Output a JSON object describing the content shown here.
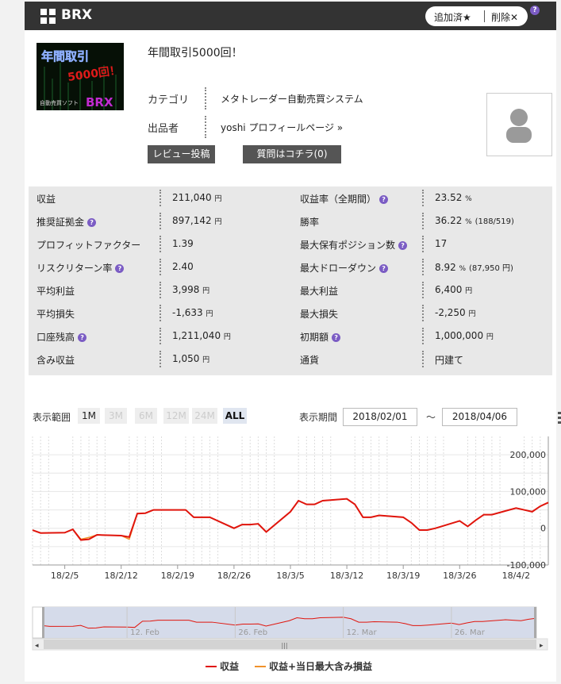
{
  "header": {
    "brand": "BRX",
    "added_label": "追加済★",
    "delete_label": "削除✕",
    "help": "?"
  },
  "product": {
    "title": "年間取引5000回！",
    "thumb_text_1": "年間取引",
    "thumb_text_2": "5000回！",
    "thumb_text_3": "自動売買ソフト",
    "thumb_text_4": "BRX",
    "category_label": "カテゴリ",
    "category_value": "メタトレーダー自動売買システム",
    "seller_label": "出品者",
    "seller_value": "yoshi プロフィールページ »",
    "review_btn": "レビュー投稿",
    "question_btn": "質問はコチラ(0)"
  },
  "stats": [
    {
      "l": "収益",
      "lq": false,
      "v": "211,040",
      "vu": "円",
      "r": "収益率（全期間）",
      "rq": true,
      "rv": "23.52",
      "ru": "%",
      "rx": ""
    },
    {
      "l": "推奨証拠金",
      "lq": true,
      "v": "897,142",
      "vu": "円",
      "r": "勝率",
      "rq": false,
      "rv": "36.22",
      "ru": "%",
      "rx": "(188/519)"
    },
    {
      "l": "プロフィットファクター",
      "lq": false,
      "v": "1.39",
      "vu": "",
      "r": "最大保有ポジション数",
      "rq": true,
      "rv": "17",
      "ru": "",
      "rx": ""
    },
    {
      "l": "リスクリターン率",
      "lq": true,
      "v": "2.40",
      "vu": "",
      "r": "最大ドローダウン",
      "rq": true,
      "rv": "8.92",
      "ru": "%",
      "rx": "(87,950 円)"
    },
    {
      "l": "平均利益",
      "lq": false,
      "v": "3,998",
      "vu": "円",
      "r": "最大利益",
      "rq": false,
      "rv": "6,400",
      "ru": "円",
      "rx": ""
    },
    {
      "l": "平均損失",
      "lq": false,
      "v": "-1,633",
      "vu": "円",
      "r": "最大損失",
      "rq": false,
      "rv": "-2,250",
      "ru": "円",
      "rx": ""
    },
    {
      "l": "口座残高",
      "lq": true,
      "v": "1,211,040",
      "vu": "円",
      "r": "初期額",
      "rq": true,
      "rv": "1,000,000",
      "ru": "円",
      "rx": ""
    },
    {
      "l": "含み収益",
      "lq": false,
      "v": "1,050",
      "vu": "円",
      "r": "通貨",
      "rq": false,
      "rv": "円建て",
      "ru": "",
      "rx": ""
    }
  ],
  "controls": {
    "range_label": "表示範囲",
    "ranges": [
      "1M",
      "3M",
      "6M",
      "12M",
      "24M",
      "ALL"
    ],
    "period_label": "表示期間",
    "date_from": "2018/02/01",
    "tilde": "～",
    "date_to": "2018/04/06"
  },
  "colors": {
    "profit": "#e0150d",
    "profit_plus": "#f0922b"
  },
  "chart_data": {
    "type": "line",
    "x_ticks": [
      "18/2/5",
      "18/2/12",
      "18/2/19",
      "18/2/26",
      "18/3/5",
      "18/3/12",
      "18/3/19",
      "18/3/26",
      "18/4/2"
    ],
    "y_ticks": [
      "200,000",
      "100,000",
      "0",
      "-100,000"
    ],
    "ylim": [
      -100000,
      250000
    ],
    "dates": [
      "02/01",
      "02/02",
      "02/05",
      "02/06",
      "02/07",
      "02/08",
      "02/09",
      "02/12",
      "02/13",
      "02/14",
      "02/15",
      "02/16",
      "02/19",
      "02/20",
      "02/21",
      "02/22",
      "02/23",
      "02/26",
      "02/27",
      "02/28",
      "03/01",
      "03/02",
      "03/05",
      "03/06",
      "03/07",
      "03/08",
      "03/09",
      "03/12",
      "03/13",
      "03/14",
      "03/15",
      "03/16",
      "03/19",
      "03/20",
      "03/21",
      "03/22",
      "03/23",
      "03/26",
      "03/27",
      "03/28",
      "03/29",
      "03/30",
      "04/02",
      "04/03",
      "04/04",
      "04/05",
      "04/06"
    ],
    "series": [
      {
        "name": "収益",
        "values": [
          -5000,
          -13000,
          -12000,
          -3000,
          -32000,
          -30000,
          -18000,
          -20000,
          -24000,
          40000,
          41000,
          50000,
          50000,
          50000,
          30000,
          30000,
          30000,
          0,
          10000,
          10000,
          12000,
          -10000,
          45000,
          75000,
          65000,
          65000,
          75000,
          80000,
          65000,
          30000,
          30000,
          35000,
          30000,
          15000,
          -5000,
          -5000,
          0,
          20000,
          5000,
          22000,
          37000,
          37000,
          55000,
          50000,
          45000,
          60000,
          70000
        ]
      },
      {
        "name": "収益+当日最大含み損益",
        "values": [
          -5000,
          -13000,
          -12000,
          -3000,
          -30000,
          -25000,
          -18000,
          -20000,
          -30000,
          40000,
          41000,
          50000,
          50000,
          50000,
          30000,
          30000,
          30000,
          0,
          10000,
          10000,
          12000,
          -10000,
          45000,
          75000,
          65000,
          65000,
          75000,
          80000,
          65000,
          30000,
          30000,
          35000,
          30000,
          15000,
          -5000,
          -5000,
          0,
          20000,
          5000,
          22000,
          37000,
          37000,
          55000,
          50000,
          45000,
          60000,
          70000
        ]
      }
    ],
    "x_axis": "date",
    "navigator_ticks": [
      "12. Feb",
      "26. Feb",
      "12. Mar",
      "26. Mar"
    ]
  }
}
